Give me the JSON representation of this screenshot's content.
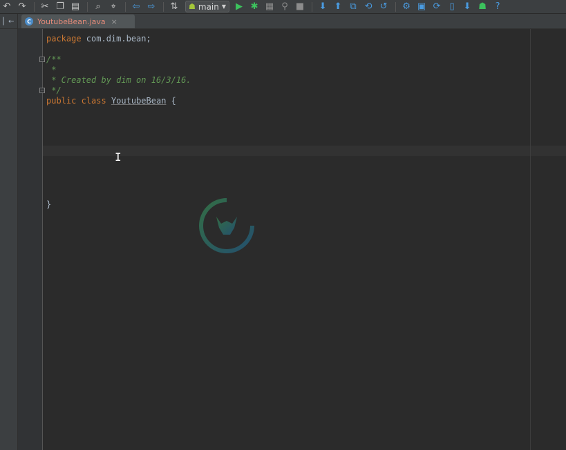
{
  "toolbar": {
    "buttons": [
      {
        "name": "undo-icon",
        "glyph": "↶"
      },
      {
        "name": "redo-icon",
        "glyph": "↷"
      },
      {
        "name": "cut-icon",
        "glyph": "✂"
      },
      {
        "name": "copy-icon",
        "glyph": "❐"
      },
      {
        "name": "paste-icon",
        "glyph": "▤"
      },
      {
        "name": "find-icon",
        "glyph": "⌕"
      },
      {
        "name": "replace-icon",
        "glyph": "⌖"
      },
      {
        "name": "back-icon",
        "glyph": "⇦"
      },
      {
        "name": "forward-icon",
        "glyph": "⇨"
      },
      {
        "name": "make-project-icon",
        "glyph": "⇅"
      }
    ],
    "run_config_label": "main",
    "run_buttons": [
      {
        "name": "run-icon",
        "glyph": "▶"
      },
      {
        "name": "debug-icon",
        "glyph": "✱"
      },
      {
        "name": "coverage-icon",
        "glyph": "▦"
      },
      {
        "name": "attach-debugger-icon",
        "glyph": "⚲"
      },
      {
        "name": "stop-icon",
        "glyph": "■"
      }
    ],
    "vcs_buttons": [
      {
        "name": "vcs-update-icon",
        "glyph": "⬇"
      },
      {
        "name": "vcs-commit-icon",
        "glyph": "⬆"
      },
      {
        "name": "vcs-compare-icon",
        "glyph": "⧉"
      },
      {
        "name": "vcs-history-icon",
        "glyph": "⟲"
      },
      {
        "name": "vcs-revert-icon",
        "glyph": "↺"
      }
    ],
    "tool_buttons": [
      {
        "name": "settings-icon",
        "glyph": "⚙"
      },
      {
        "name": "project-structure-icon",
        "glyph": "▣"
      },
      {
        "name": "gradle-sync-icon",
        "glyph": "⟳"
      },
      {
        "name": "avd-manager-icon",
        "glyph": "▯"
      },
      {
        "name": "sdk-manager-icon",
        "glyph": "⬇"
      },
      {
        "name": "android-monitor-icon",
        "glyph": "☗"
      },
      {
        "name": "help-icon",
        "glyph": "?"
      }
    ]
  },
  "tabs": {
    "active": {
      "label": "YoutubeBean.java",
      "icon": "C",
      "close": "×"
    }
  },
  "code": {
    "line1_kw": "package",
    "line1_rest": " com.dim.bean;",
    "line3": "/**",
    "line4": " *",
    "line5": " * Created by dim on 16/3/16.",
    "line6": " */",
    "line7_kw1": "public",
    "line7_kw2": "class",
    "line7_class": "YoutubeBean",
    "line7_brace": " {",
    "line12": "}"
  },
  "colors": {
    "background": "#2b2b2b",
    "keyword": "#cc7832",
    "comment": "#629755",
    "text": "#a9b7c6",
    "tab_label": "#e28a79"
  }
}
